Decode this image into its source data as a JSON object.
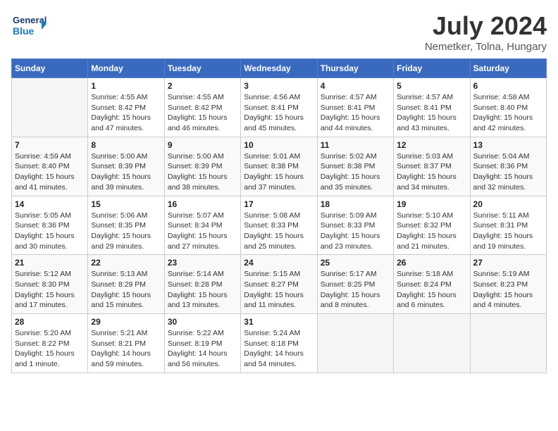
{
  "header": {
    "logo_line1": "General",
    "logo_line2": "Blue",
    "month_year": "July 2024",
    "location": "Nemetker, Tolna, Hungary"
  },
  "weekdays": [
    "Sunday",
    "Monday",
    "Tuesday",
    "Wednesday",
    "Thursday",
    "Friday",
    "Saturday"
  ],
  "weeks": [
    [
      {
        "num": "",
        "detail": ""
      },
      {
        "num": "1",
        "detail": "Sunrise: 4:55 AM\nSunset: 8:42 PM\nDaylight: 15 hours\nand 47 minutes."
      },
      {
        "num": "2",
        "detail": "Sunrise: 4:55 AM\nSunset: 8:42 PM\nDaylight: 15 hours\nand 46 minutes."
      },
      {
        "num": "3",
        "detail": "Sunrise: 4:56 AM\nSunset: 8:41 PM\nDaylight: 15 hours\nand 45 minutes."
      },
      {
        "num": "4",
        "detail": "Sunrise: 4:57 AM\nSunset: 8:41 PM\nDaylight: 15 hours\nand 44 minutes."
      },
      {
        "num": "5",
        "detail": "Sunrise: 4:57 AM\nSunset: 8:41 PM\nDaylight: 15 hours\nand 43 minutes."
      },
      {
        "num": "6",
        "detail": "Sunrise: 4:58 AM\nSunset: 8:40 PM\nDaylight: 15 hours\nand 42 minutes."
      }
    ],
    [
      {
        "num": "7",
        "detail": "Sunrise: 4:59 AM\nSunset: 8:40 PM\nDaylight: 15 hours\nand 41 minutes."
      },
      {
        "num": "8",
        "detail": "Sunrise: 5:00 AM\nSunset: 8:39 PM\nDaylight: 15 hours\nand 39 minutes."
      },
      {
        "num": "9",
        "detail": "Sunrise: 5:00 AM\nSunset: 8:39 PM\nDaylight: 15 hours\nand 38 minutes."
      },
      {
        "num": "10",
        "detail": "Sunrise: 5:01 AM\nSunset: 8:38 PM\nDaylight: 15 hours\nand 37 minutes."
      },
      {
        "num": "11",
        "detail": "Sunrise: 5:02 AM\nSunset: 8:38 PM\nDaylight: 15 hours\nand 35 minutes."
      },
      {
        "num": "12",
        "detail": "Sunrise: 5:03 AM\nSunset: 8:37 PM\nDaylight: 15 hours\nand 34 minutes."
      },
      {
        "num": "13",
        "detail": "Sunrise: 5:04 AM\nSunset: 8:36 PM\nDaylight: 15 hours\nand 32 minutes."
      }
    ],
    [
      {
        "num": "14",
        "detail": "Sunrise: 5:05 AM\nSunset: 8:36 PM\nDaylight: 15 hours\nand 30 minutes."
      },
      {
        "num": "15",
        "detail": "Sunrise: 5:06 AM\nSunset: 8:35 PM\nDaylight: 15 hours\nand 29 minutes."
      },
      {
        "num": "16",
        "detail": "Sunrise: 5:07 AM\nSunset: 8:34 PM\nDaylight: 15 hours\nand 27 minutes."
      },
      {
        "num": "17",
        "detail": "Sunrise: 5:08 AM\nSunset: 8:33 PM\nDaylight: 15 hours\nand 25 minutes."
      },
      {
        "num": "18",
        "detail": "Sunrise: 5:09 AM\nSunset: 8:33 PM\nDaylight: 15 hours\nand 23 minutes."
      },
      {
        "num": "19",
        "detail": "Sunrise: 5:10 AM\nSunset: 8:32 PM\nDaylight: 15 hours\nand 21 minutes."
      },
      {
        "num": "20",
        "detail": "Sunrise: 5:11 AM\nSunset: 8:31 PM\nDaylight: 15 hours\nand 19 minutes."
      }
    ],
    [
      {
        "num": "21",
        "detail": "Sunrise: 5:12 AM\nSunset: 8:30 PM\nDaylight: 15 hours\nand 17 minutes."
      },
      {
        "num": "22",
        "detail": "Sunrise: 5:13 AM\nSunset: 8:29 PM\nDaylight: 15 hours\nand 15 minutes."
      },
      {
        "num": "23",
        "detail": "Sunrise: 5:14 AM\nSunset: 8:28 PM\nDaylight: 15 hours\nand 13 minutes."
      },
      {
        "num": "24",
        "detail": "Sunrise: 5:15 AM\nSunset: 8:27 PM\nDaylight: 15 hours\nand 11 minutes."
      },
      {
        "num": "25",
        "detail": "Sunrise: 5:17 AM\nSunset: 8:25 PM\nDaylight: 15 hours\nand 8 minutes."
      },
      {
        "num": "26",
        "detail": "Sunrise: 5:18 AM\nSunset: 8:24 PM\nDaylight: 15 hours\nand 6 minutes."
      },
      {
        "num": "27",
        "detail": "Sunrise: 5:19 AM\nSunset: 8:23 PM\nDaylight: 15 hours\nand 4 minutes."
      }
    ],
    [
      {
        "num": "28",
        "detail": "Sunrise: 5:20 AM\nSunset: 8:22 PM\nDaylight: 15 hours\nand 1 minute."
      },
      {
        "num": "29",
        "detail": "Sunrise: 5:21 AM\nSunset: 8:21 PM\nDaylight: 14 hours\nand 59 minutes."
      },
      {
        "num": "30",
        "detail": "Sunrise: 5:22 AM\nSunset: 8:19 PM\nDaylight: 14 hours\nand 56 minutes."
      },
      {
        "num": "31",
        "detail": "Sunrise: 5:24 AM\nSunset: 8:18 PM\nDaylight: 14 hours\nand 54 minutes."
      },
      {
        "num": "",
        "detail": ""
      },
      {
        "num": "",
        "detail": ""
      },
      {
        "num": "",
        "detail": ""
      }
    ]
  ]
}
